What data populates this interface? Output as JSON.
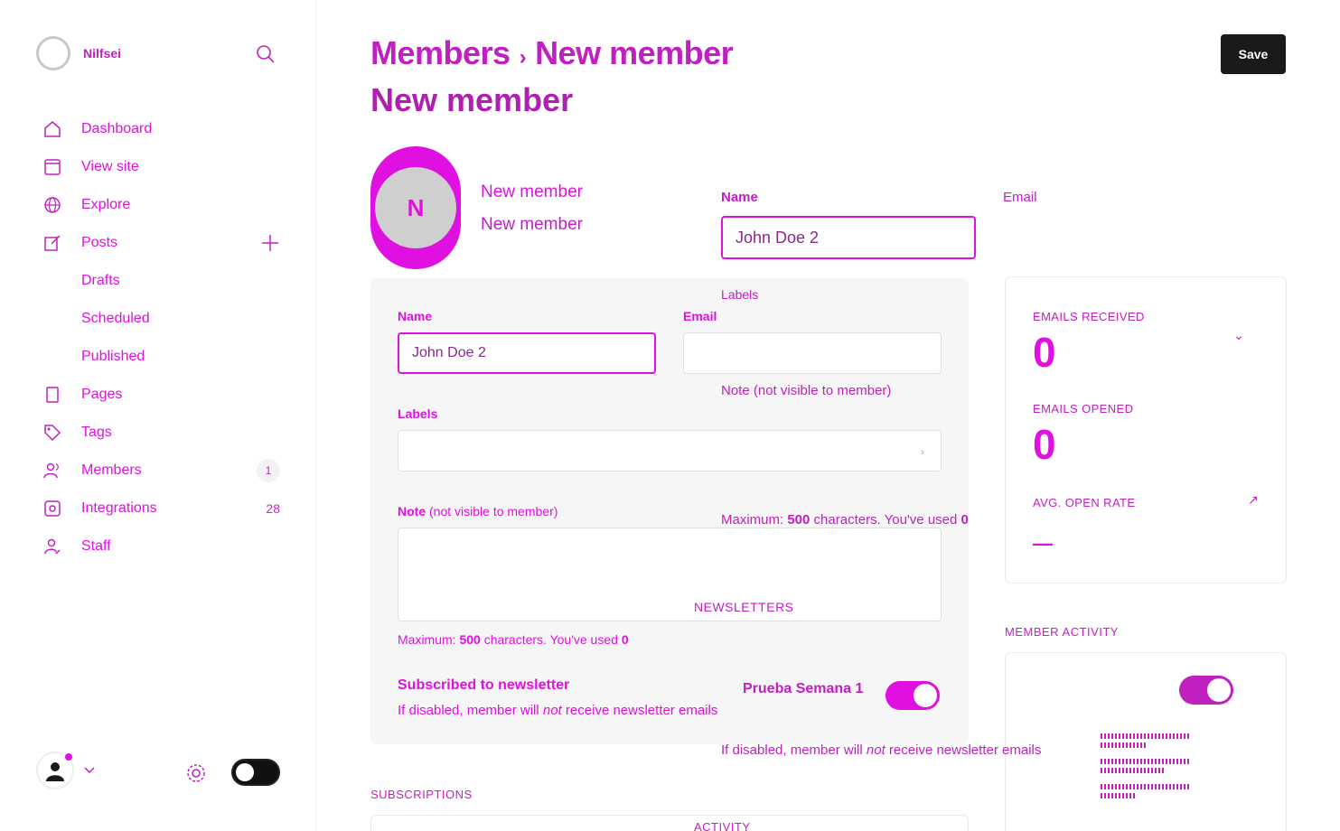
{
  "brand": {
    "name": "Nilfsei",
    "logo_icon": "circle-logo-icon"
  },
  "sidebar": {
    "search_icon": "search-icon",
    "items": [
      {
        "label": "Dashboard",
        "icon": "home-icon"
      },
      {
        "label": "View site",
        "icon": "browser-icon"
      },
      {
        "label": "Explore",
        "icon": "globe-icon"
      },
      {
        "label": "Posts",
        "icon": "edit-icon",
        "action": "+"
      }
    ],
    "post_subitems": [
      "Drafts",
      "Scheduled",
      "Published"
    ],
    "items2": [
      {
        "label": "Pages",
        "icon": "page-icon"
      },
      {
        "label": "Tags",
        "icon": "tag-icon"
      },
      {
        "label": "Members",
        "icon": "members-icon",
        "count": "1"
      },
      {
        "label": "Integrations",
        "icon": "integrations-icon",
        "count": "28"
      },
      {
        "label": "Staff",
        "icon": "staff-icon"
      }
    ]
  },
  "header": {
    "breadcrumb_parent": "Members",
    "breadcrumb_sep": "›",
    "breadcrumb_current": "New member",
    "title": "New member",
    "save_label": "Save"
  },
  "member": {
    "initials": "N",
    "name": "New member",
    "subtitle": "New member"
  },
  "form": {
    "name_label": "Name",
    "name_value": "John Doe 2",
    "email_label": "Email",
    "email_value": "",
    "labels_label": "Labels",
    "note_label": "Note",
    "note_suffix": "(not visible to member)",
    "note_full": "Note (not visible to member)",
    "max_prefix": "Maximum: ",
    "max_count": "500",
    "max_mid": " characters. You've used ",
    "max_used": "0"
  },
  "newsletter": {
    "section_label": "NEWSLETTERS",
    "title": "Subscribed to newsletter",
    "name": "Prueba Semana 1",
    "desc_prefix": "If disabled, member will ",
    "desc_em": "not",
    "desc_suffix": " receive newsletter emails",
    "enabled": true
  },
  "sections": {
    "subscriptions": "SUBSCRIPTIONS",
    "activity": "ACTIVITY",
    "member_activity": "MEMBER ACTIVITY"
  },
  "stats": {
    "emails_received_label": "EMAILS RECEIVED",
    "emails_received": "0",
    "emails_opened_label": "EMAILS OPENED",
    "emails_opened": "0",
    "open_rate_label": "AVG. OPEN RATE",
    "open_rate": "—"
  },
  "colors": {
    "accent": "#e010e0",
    "dark": "#1a1a1a",
    "muted": "#c020c0"
  }
}
